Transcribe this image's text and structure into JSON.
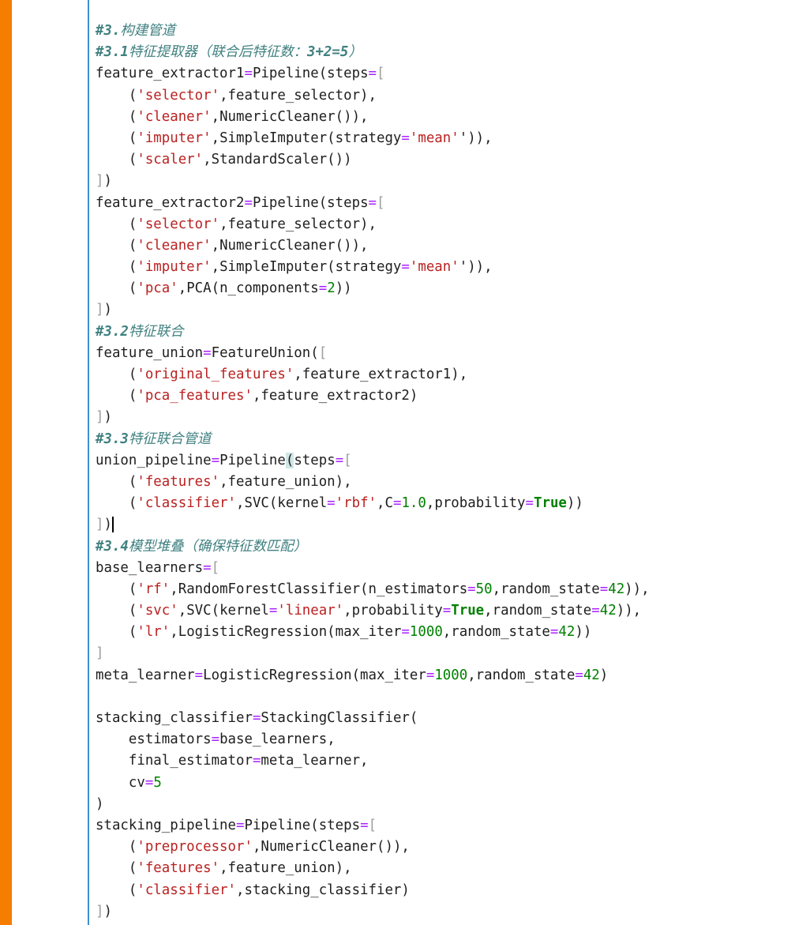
{
  "colors": {
    "left_accent_bar": "#f57d00",
    "cell_border": "#3f8fd0",
    "operator": "#aa22ff",
    "string": "#ba2121",
    "number": "#008000",
    "keyword": "#008000",
    "comment": "#408080",
    "bracket_muted": "#9e9e9e",
    "match_highlight": "#cfe6e6"
  },
  "token_type_legend": {
    "n": "name / plain text",
    "o": "operator (=)",
    "s": "string literal",
    "m": "number literal",
    "k": "keyword (True)",
    "c": "comment (ascii part)",
    "c-cjk": "comment (CJK part)",
    "b": "bracket",
    "hl": "matching bracket highlight",
    "cur": "bracket with text cursor"
  },
  "code_lines": [
    [
      [
        "c",
        "#3."
      ],
      [
        "c-cjk",
        "构建管道"
      ]
    ],
    [
      [
        "c",
        "#3.1"
      ],
      [
        "c-cjk",
        "特征提取器（联合后特征数："
      ],
      [
        "c",
        "3+2=5"
      ],
      [
        "c-cjk",
        "）"
      ]
    ],
    [
      [
        "n",
        "feature_extractor1"
      ],
      [
        "o",
        "="
      ],
      [
        "n",
        "Pipeline(steps"
      ],
      [
        "o",
        "="
      ],
      [
        "b",
        "["
      ]
    ],
    [
      [
        "n",
        "    ("
      ],
      [
        "s",
        "'selector'"
      ],
      [
        "n",
        ",feature_selector),"
      ]
    ],
    [
      [
        "n",
        "    ("
      ],
      [
        "s",
        "'cleaner'"
      ],
      [
        "n",
        ",NumericCleaner()),"
      ]
    ],
    [
      [
        "n",
        "    ("
      ],
      [
        "s",
        "'imputer'"
      ],
      [
        "n",
        ",SimpleImputer(strategy"
      ],
      [
        "o",
        "="
      ],
      [
        "s",
        "'mean'"
      ],
      [
        "n",
        "')),"
      ]
    ],
    [
      [
        "n",
        "    ("
      ],
      [
        "s",
        "'scaler'"
      ],
      [
        "n",
        ",StandardScaler())"
      ]
    ],
    [
      [
        "b",
        "]"
      ],
      [
        "n",
        ")"
      ]
    ],
    [
      [
        "n",
        "feature_extractor2"
      ],
      [
        "o",
        "="
      ],
      [
        "n",
        "Pipeline(steps"
      ],
      [
        "o",
        "="
      ],
      [
        "b",
        "["
      ]
    ],
    [
      [
        "n",
        "    ("
      ],
      [
        "s",
        "'selector'"
      ],
      [
        "n",
        ",feature_selector),"
      ]
    ],
    [
      [
        "n",
        "    ("
      ],
      [
        "s",
        "'cleaner'"
      ],
      [
        "n",
        ",NumericCleaner()),"
      ]
    ],
    [
      [
        "n",
        "    ("
      ],
      [
        "s",
        "'imputer'"
      ],
      [
        "n",
        ",SimpleImputer(strategy"
      ],
      [
        "o",
        "="
      ],
      [
        "s",
        "'mean'"
      ],
      [
        "n",
        "')),"
      ]
    ],
    [
      [
        "n",
        "    ("
      ],
      [
        "s",
        "'pca'"
      ],
      [
        "n",
        ",PCA(n_components"
      ],
      [
        "o",
        "="
      ],
      [
        "m",
        "2"
      ],
      [
        "n",
        "))"
      ]
    ],
    [
      [
        "b",
        "]"
      ],
      [
        "n",
        ")"
      ]
    ],
    [
      [
        "c",
        "#3.2"
      ],
      [
        "c-cjk",
        "特征联合"
      ]
    ],
    [
      [
        "n",
        "feature_union"
      ],
      [
        "o",
        "="
      ],
      [
        "n",
        "FeatureUnion("
      ],
      [
        "b",
        "["
      ]
    ],
    [
      [
        "n",
        "    ("
      ],
      [
        "s",
        "'original_features'"
      ],
      [
        "n",
        ",feature_extractor1),"
      ]
    ],
    [
      [
        "n",
        "    ("
      ],
      [
        "s",
        "'pca_features'"
      ],
      [
        "n",
        ",feature_extractor2)"
      ]
    ],
    [
      [
        "b",
        "]"
      ],
      [
        "n",
        ")"
      ]
    ],
    [
      [
        "c",
        "#3.3"
      ],
      [
        "c-cjk",
        "特征联合管道"
      ]
    ],
    [
      [
        "n",
        "union_pipeline"
      ],
      [
        "o",
        "="
      ],
      [
        "n",
        "Pipeline"
      ],
      [
        "hl",
        "("
      ],
      [
        "n",
        "steps"
      ],
      [
        "o",
        "="
      ],
      [
        "b",
        "["
      ]
    ],
    [
      [
        "n",
        "    ("
      ],
      [
        "s",
        "'features'"
      ],
      [
        "n",
        ",feature_union),"
      ]
    ],
    [
      [
        "n",
        "    ("
      ],
      [
        "s",
        "'classifier'"
      ],
      [
        "n",
        ",SVC(kernel"
      ],
      [
        "o",
        "="
      ],
      [
        "s",
        "'rbf'"
      ],
      [
        "n",
        ",C"
      ],
      [
        "o",
        "="
      ],
      [
        "m",
        "1.0"
      ],
      [
        "n",
        ",probability"
      ],
      [
        "o",
        "="
      ],
      [
        "k",
        "True"
      ],
      [
        "n",
        "))"
      ]
    ],
    [
      [
        "b",
        "]"
      ],
      [
        "cur",
        ")"
      ]
    ],
    [
      [
        "c",
        "#3.4"
      ],
      [
        "c-cjk",
        "模型堆叠（确保特征数匹配）"
      ]
    ],
    [
      [
        "n",
        "base_learners"
      ],
      [
        "o",
        "="
      ],
      [
        "b",
        "["
      ]
    ],
    [
      [
        "n",
        "    ("
      ],
      [
        "s",
        "'rf'"
      ],
      [
        "n",
        ",RandomForestClassifier(n_estimators"
      ],
      [
        "o",
        "="
      ],
      [
        "m",
        "50"
      ],
      [
        "n",
        ",random_state"
      ],
      [
        "o",
        "="
      ],
      [
        "m",
        "42"
      ],
      [
        "n",
        ")),"
      ]
    ],
    [
      [
        "n",
        "    ("
      ],
      [
        "s",
        "'svc'"
      ],
      [
        "n",
        ",SVC(kernel"
      ],
      [
        "o",
        "="
      ],
      [
        "s",
        "'linear'"
      ],
      [
        "n",
        ",probability"
      ],
      [
        "o",
        "="
      ],
      [
        "k",
        "True"
      ],
      [
        "n",
        ",random_state"
      ],
      [
        "o",
        "="
      ],
      [
        "m",
        "42"
      ],
      [
        "n",
        ")),"
      ]
    ],
    [
      [
        "n",
        "    ("
      ],
      [
        "s",
        "'lr'"
      ],
      [
        "n",
        ",LogisticRegression(max_iter"
      ],
      [
        "o",
        "="
      ],
      [
        "m",
        "1000"
      ],
      [
        "n",
        ",random_state"
      ],
      [
        "o",
        "="
      ],
      [
        "m",
        "42"
      ],
      [
        "n",
        "))"
      ]
    ],
    [
      [
        "b",
        "]"
      ]
    ],
    [
      [
        "n",
        "meta_learner"
      ],
      [
        "o",
        "="
      ],
      [
        "n",
        "LogisticRegression(max_iter"
      ],
      [
        "o",
        "="
      ],
      [
        "m",
        "1000"
      ],
      [
        "n",
        ",random_state"
      ],
      [
        "o",
        "="
      ],
      [
        "m",
        "42"
      ],
      [
        "n",
        ")"
      ]
    ],
    [],
    [
      [
        "n",
        "stacking_classifier"
      ],
      [
        "o",
        "="
      ],
      [
        "n",
        "StackingClassifier("
      ]
    ],
    [
      [
        "n",
        "    estimators"
      ],
      [
        "o",
        "="
      ],
      [
        "n",
        "base_learners,"
      ]
    ],
    [
      [
        "n",
        "    final_estimator"
      ],
      [
        "o",
        "="
      ],
      [
        "n",
        "meta_learner,"
      ]
    ],
    [
      [
        "n",
        "    cv"
      ],
      [
        "o",
        "="
      ],
      [
        "m",
        "5"
      ]
    ],
    [
      [
        "n",
        ")"
      ]
    ],
    [
      [
        "n",
        "stacking_pipeline"
      ],
      [
        "o",
        "="
      ],
      [
        "n",
        "Pipeline(steps"
      ],
      [
        "o",
        "="
      ],
      [
        "b",
        "["
      ]
    ],
    [
      [
        "n",
        "    ("
      ],
      [
        "s",
        "'preprocessor'"
      ],
      [
        "n",
        ",NumericCleaner()),"
      ]
    ],
    [
      [
        "n",
        "    ("
      ],
      [
        "s",
        "'features'"
      ],
      [
        "n",
        ",feature_union),"
      ]
    ],
    [
      [
        "n",
        "    ("
      ],
      [
        "s",
        "'classifier'"
      ],
      [
        "n",
        ",stacking_classifier)"
      ]
    ],
    [
      [
        "b",
        "]"
      ],
      [
        "n",
        ")"
      ]
    ]
  ]
}
